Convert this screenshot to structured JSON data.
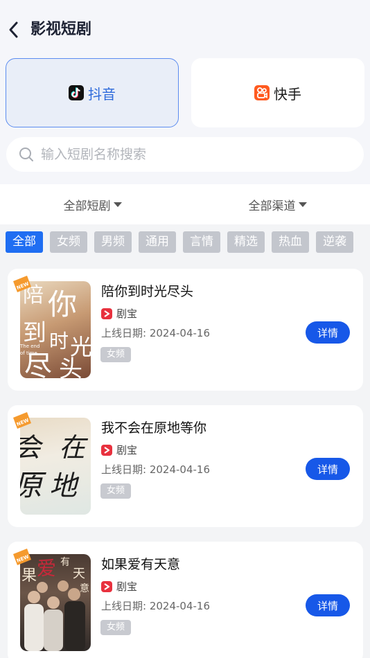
{
  "header": {
    "title": "影视短剧"
  },
  "platforms": [
    {
      "label": "抖音",
      "icon": "douyin-icon",
      "selected": true
    },
    {
      "label": "快手",
      "icon": "kuaishou-icon",
      "selected": false
    }
  ],
  "search": {
    "placeholder": "输入短剧名称搜索"
  },
  "filters": {
    "drama": "全部短剧",
    "channel": "全部渠道"
  },
  "tags": [
    {
      "label": "全部",
      "active": true
    },
    {
      "label": "女频"
    },
    {
      "label": "男频"
    },
    {
      "label": "通用"
    },
    {
      "label": "言情"
    },
    {
      "label": "精选"
    },
    {
      "label": "热血"
    },
    {
      "label": "逆袭"
    }
  ],
  "dramas": [
    {
      "title": "陪你到时光尽头",
      "source": "剧宝",
      "date": "上线日期: 2024-04-16",
      "genre": "女频",
      "detail_label": "详情",
      "poster_text": [
        "陪",
        "你",
        "到",
        "时",
        "光",
        "尽",
        "头"
      ],
      "poster_sub": [
        "The end",
        "of time"
      ]
    },
    {
      "title": "我不会在原地等你",
      "source": "剧宝",
      "date": "上线日期: 2024-04-16",
      "genre": "女频",
      "detail_label": "详情",
      "poster_text": [
        "会",
        "在",
        "原",
        "地"
      ]
    },
    {
      "title": "如果爱有天意",
      "source": "剧宝",
      "date": "上线日期: 2024-04-16",
      "genre": "女频",
      "detail_label": "详情",
      "poster_text": [
        "果",
        "爱",
        "有",
        "天",
        "意"
      ]
    }
  ],
  "badge": {
    "label": "NEW"
  },
  "colors": {
    "accent": "#1f6ef2",
    "douyin": "#111111",
    "kuaishou": "#ff5a1f",
    "source": "#e8313e"
  }
}
